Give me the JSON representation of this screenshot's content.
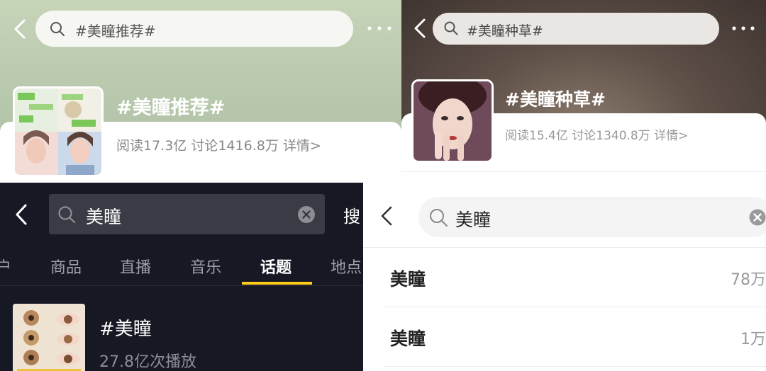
{
  "panel_a": {
    "search_query": "#美瞳推荐#",
    "topic_title": "#美瞳推荐#",
    "stats": "阅读17.3亿 讨论1416.8万 详情>"
  },
  "panel_b": {
    "search_query": "#美瞳种草#",
    "topic_title": "#美瞳种草#",
    "stats": "阅读15.4亿 讨论1340.8万 详情>"
  },
  "panel_c": {
    "search_query": "美瞳",
    "search_button": "搜",
    "tabs": [
      {
        "label": "户"
      },
      {
        "label": "商品"
      },
      {
        "label": "直播"
      },
      {
        "label": "音乐"
      },
      {
        "label": "话题",
        "active": true
      },
      {
        "label": "地点"
      }
    ],
    "result_title": "#美瞳",
    "result_sub": "27.8亿次播放",
    "accent_color": "#fecd1c"
  },
  "panel_d": {
    "search_query": "美瞳",
    "results": [
      {
        "name": "美瞳",
        "count": "78万"
      },
      {
        "name": "美瞳",
        "count": "1万"
      }
    ]
  }
}
